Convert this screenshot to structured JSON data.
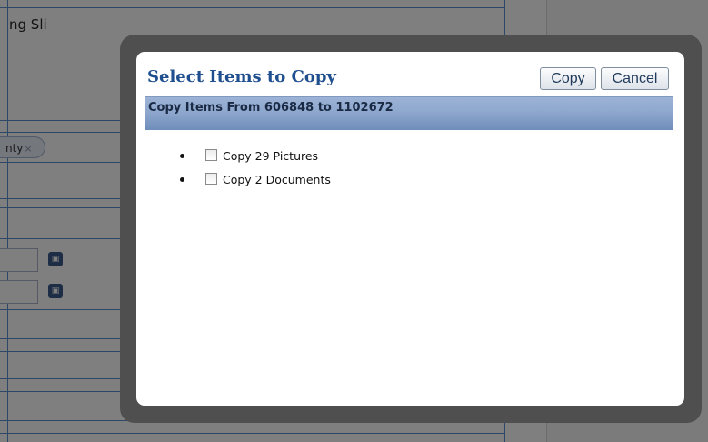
{
  "background": {
    "page_title_fragment": "ng Sli",
    "tag": {
      "label": "nty",
      "remove_glyph": "×"
    },
    "calendar_glyph": "▣"
  },
  "dialog": {
    "title": "Select Items to Copy",
    "copy_button": "Copy",
    "cancel_button": "Cancel",
    "header_text": "Copy Items From 606848 to 1102672",
    "items": [
      {
        "label": "Copy 29 Pictures",
        "checked": false
      },
      {
        "label": "Copy 2 Documents",
        "checked": false
      }
    ]
  },
  "colors": {
    "title": "#1f4f8f",
    "header_bar": "#8ea7cd",
    "frame": "#4f4f4f"
  }
}
